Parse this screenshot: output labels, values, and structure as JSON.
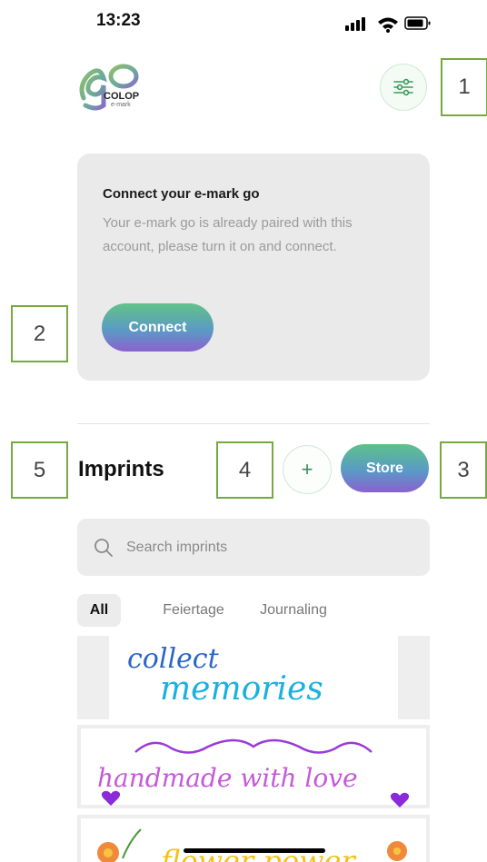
{
  "status": {
    "time": "13:23"
  },
  "header": {
    "logo_main": "go",
    "logo_sub": "COLOP",
    "logo_mark": "e-mark"
  },
  "annotations": {
    "a1": "1",
    "a2": "2",
    "a3": "3",
    "a4": "4",
    "a5": "5"
  },
  "connect_card": {
    "title": "Connect your e-mark go",
    "body": "Your e-mark go is already paired with this account, please turn it on and connect.",
    "button": "Connect"
  },
  "imprints": {
    "title": "Imprints",
    "plus": "+",
    "store_button": "Store",
    "search_placeholder": "Search imprints",
    "filters": [
      "All",
      "Feiertage",
      "Journaling"
    ],
    "items": [
      {
        "line1": "collect",
        "line2": "memories"
      },
      {
        "line1": "handmade with love"
      },
      {
        "line1": "flower power"
      }
    ]
  },
  "colors": {
    "accent_green": "#77a842",
    "gradient_start": "#5cc28a",
    "gradient_end": "#8a61cf"
  }
}
